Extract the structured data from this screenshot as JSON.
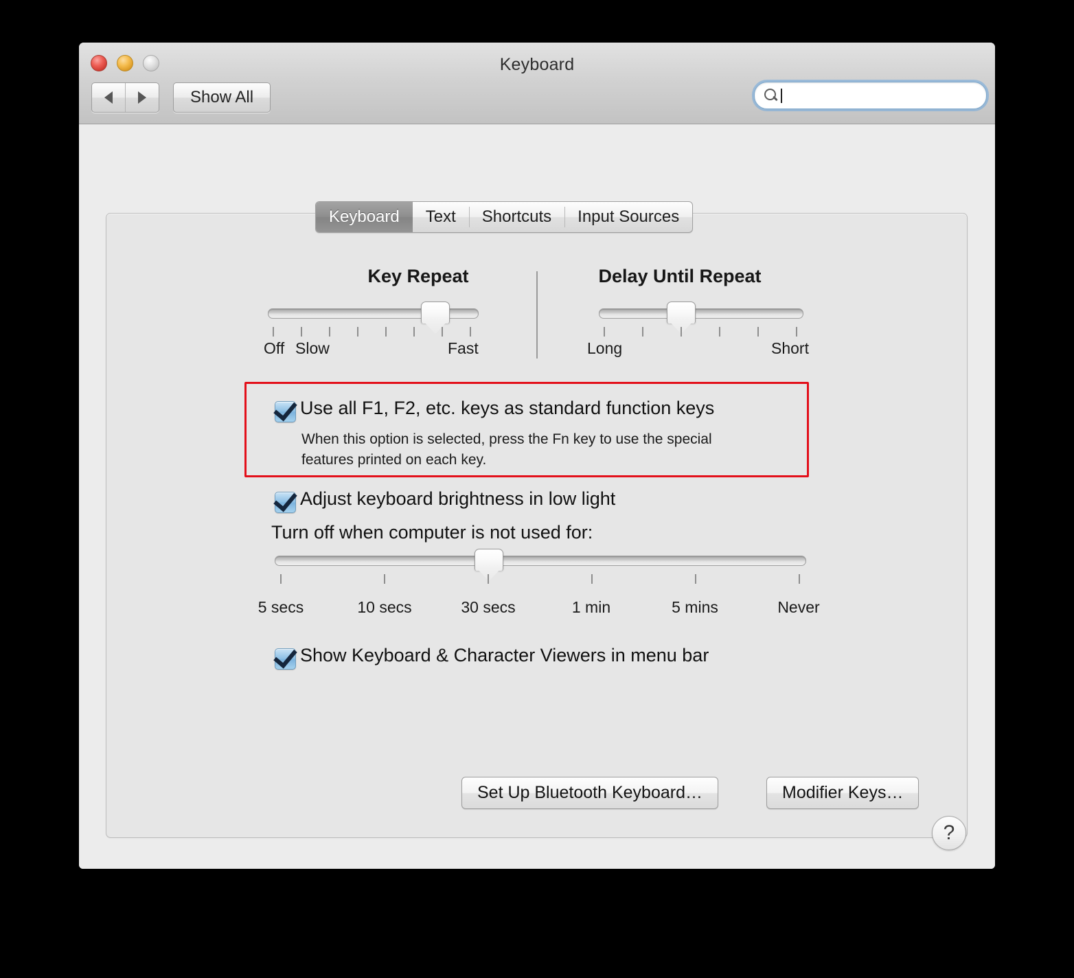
{
  "window": {
    "title": "Keyboard",
    "traffic_lights": [
      "close-button",
      "minimize-button",
      "zoom-button"
    ],
    "toolbar": {
      "back_icon": "back-arrow-icon",
      "forward_icon": "forward-arrow-icon",
      "show_all_label": "Show All",
      "search": {
        "value": "",
        "placeholder": "",
        "icon": "search-icon"
      }
    }
  },
  "tabs": [
    {
      "label": "Keyboard",
      "active": true
    },
    {
      "label": "Text",
      "active": false
    },
    {
      "label": "Shortcuts",
      "active": false
    },
    {
      "label": "Input Sources",
      "active": false
    }
  ],
  "key_repeat": {
    "title": "Key Repeat",
    "ticks": 8,
    "thumb_index": 6,
    "labels": {
      "min_off": "Off",
      "min": "Slow",
      "max": "Fast"
    }
  },
  "delay_until_repeat": {
    "title": "Delay Until Repeat",
    "ticks": 6,
    "thumb_index": 2,
    "labels": {
      "min": "Long",
      "max": "Short"
    }
  },
  "options": {
    "fn_keys": {
      "label": "Use all F1, F2, etc. keys as standard function keys",
      "checked": true,
      "description_line1": "When this option is selected, press the Fn key to use the special",
      "description_line2": "features printed on each key.",
      "highlight_color": "#e30f1a"
    },
    "brightness": {
      "label": "Adjust keyboard brightness in low light",
      "checked": true
    },
    "turn_off_label": "Turn off when computer is not used for:",
    "turn_off_slider": {
      "ticks": 6,
      "thumb_index": 2,
      "tick_labels": [
        "5 secs",
        "10 secs",
        "30 secs",
        "1 min",
        "5 mins",
        "Never"
      ]
    },
    "viewers": {
      "label": "Show Keyboard & Character Viewers in menu bar",
      "checked": true
    }
  },
  "buttons": {
    "bluetooth": "Set Up Bluetooth Keyboard…",
    "modifier": "Modifier Keys…",
    "help": "?"
  }
}
